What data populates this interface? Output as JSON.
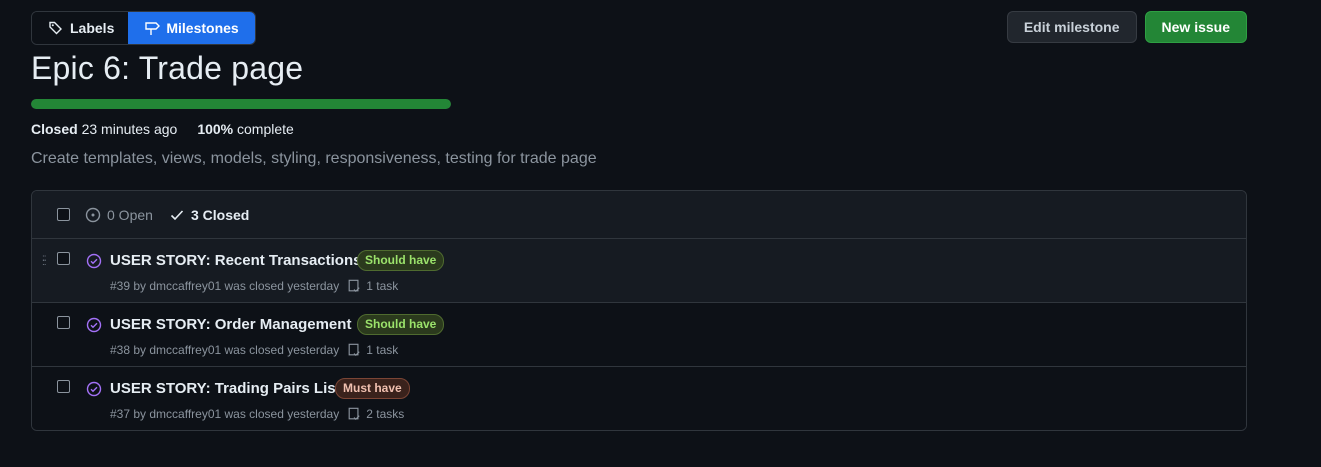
{
  "nav": {
    "labels": "Labels",
    "milestones": "Milestones"
  },
  "actions": {
    "edit": "Edit milestone",
    "new_issue": "New issue"
  },
  "milestone": {
    "title": "Epic 6: Trade page",
    "progress_percent": 100,
    "status": "Closed",
    "closed_time": "23 minutes ago",
    "percent_text": "100%",
    "complete_text": "complete",
    "description": "Create templates, views, models, styling, responsiveness, testing for trade page"
  },
  "filters": {
    "open": "0 Open",
    "closed": "3 Closed"
  },
  "issues": [
    {
      "title": "USER STORY: Recent Transactions",
      "label": "Should have",
      "meta": "#39 by dmccaffrey01 was closed yesterday",
      "tasks": "1 task"
    },
    {
      "title": "USER STORY: Order Management",
      "label": "Should have",
      "meta": "#38 by dmccaffrey01 was closed yesterday",
      "tasks": "1 task"
    },
    {
      "title": "USER STORY: Trading Pairs List",
      "label": "Must have",
      "meta": "#37 by dmccaffrey01 was closed yesterday",
      "tasks": "2 tasks"
    }
  ],
  "colors": {
    "accent": "#1f6feb",
    "success": "#238636",
    "closed_icon": "#a371f7"
  }
}
